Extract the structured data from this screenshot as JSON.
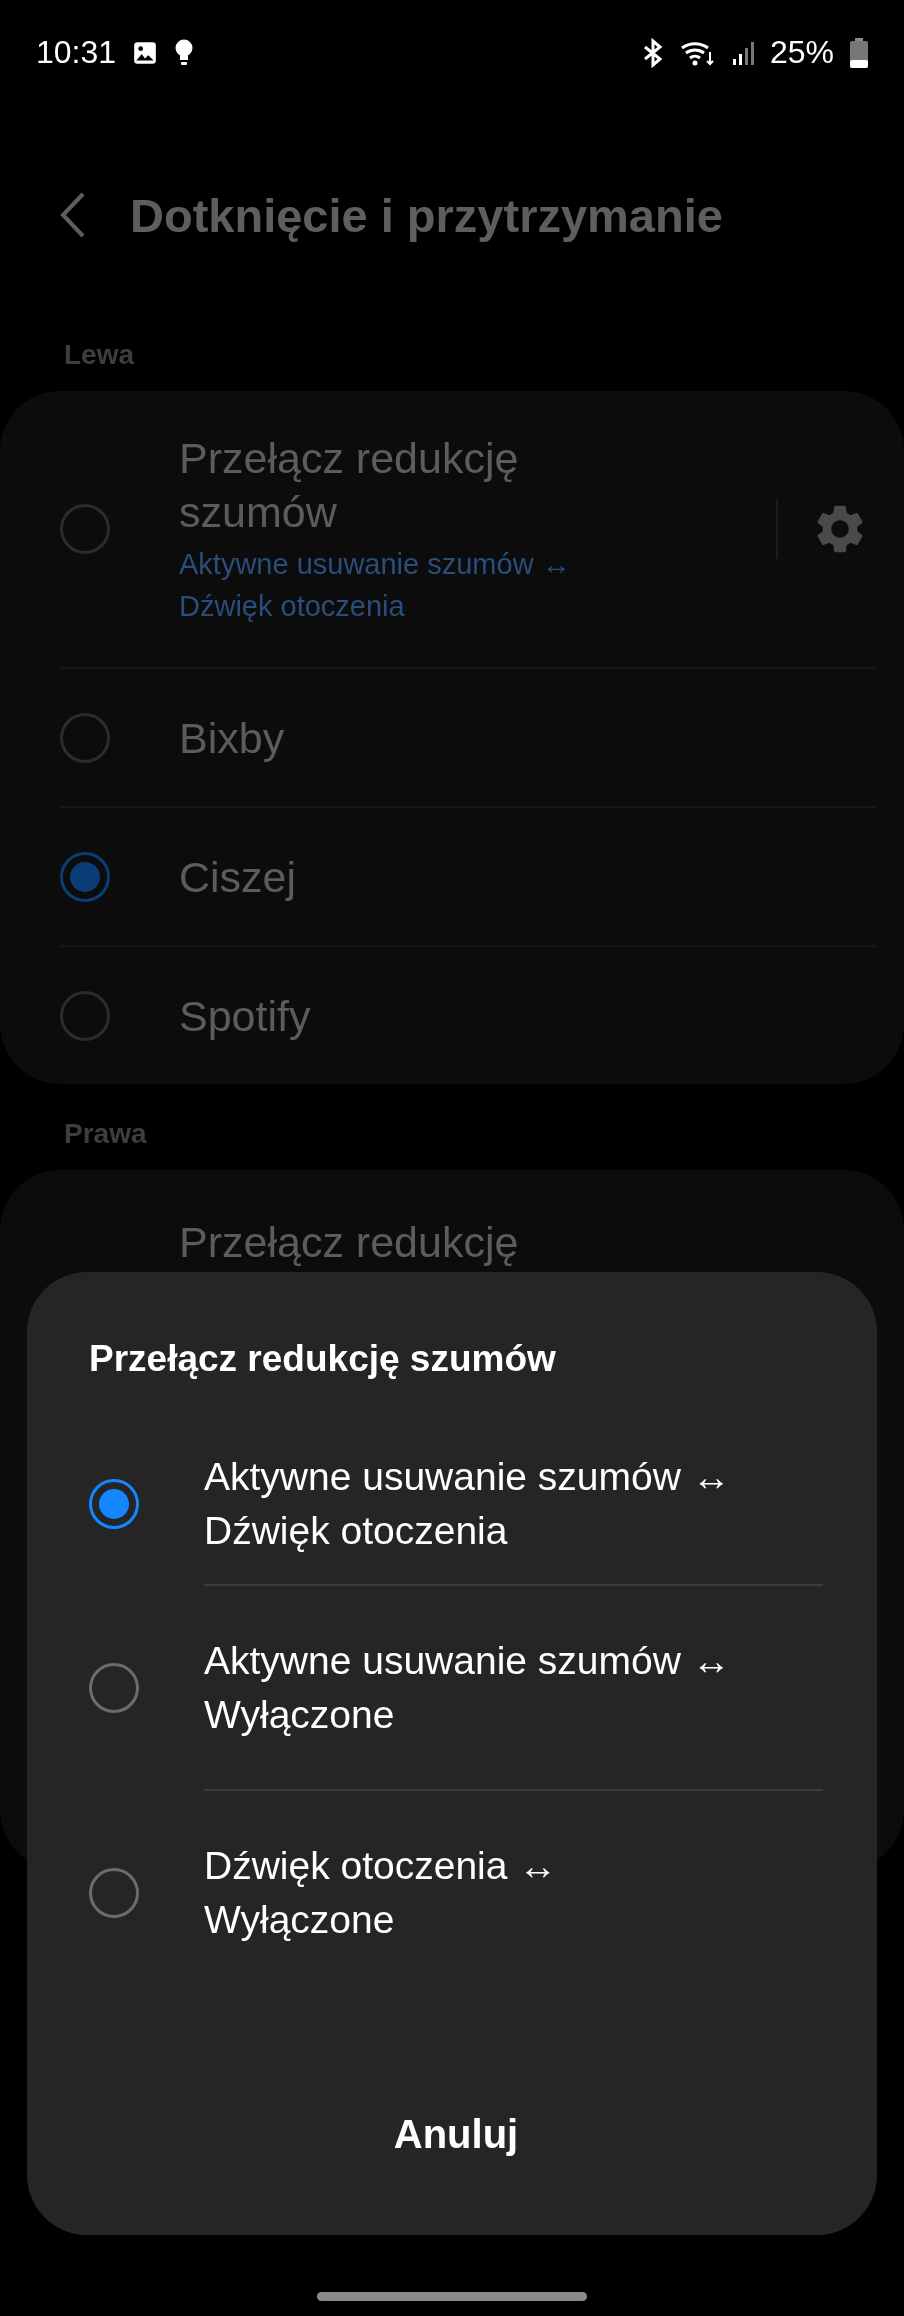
{
  "status_bar": {
    "time": "10:31",
    "battery": "25%"
  },
  "header": {
    "title": "Dotknięcie i przytrzymanie"
  },
  "sections": [
    {
      "label": "Lewa",
      "items": [
        {
          "title": "Przełącz redukcję\nszumów",
          "subtitle": "Aktywne usuwanie szumów ↔\nDźwięk otoczenia",
          "selected": false,
          "kind": "settings"
        },
        {
          "title": "Bixby",
          "selected": false,
          "kind": "plain"
        },
        {
          "title": "Ciszej",
          "selected": true,
          "kind": "plain"
        },
        {
          "title": "Spotify",
          "selected": false,
          "kind": "plain"
        }
      ]
    },
    {
      "label": "Prawa",
      "items": [
        {
          "title": "Przełącz redukcję",
          "kind": "partial"
        }
      ]
    }
  ],
  "dialog": {
    "title": "Przełącz redukcję szumów",
    "options": [
      {
        "label": "Aktywne usuwanie szumów ↔\nDźwięk otoczenia",
        "selected": true
      },
      {
        "label": "Aktywne usuwanie szumów ↔\nWyłączone",
        "selected": false
      },
      {
        "label": "Dźwięk otoczenia ↔\nWyłączone",
        "selected": false
      }
    ],
    "cancel": "Anuluj"
  }
}
